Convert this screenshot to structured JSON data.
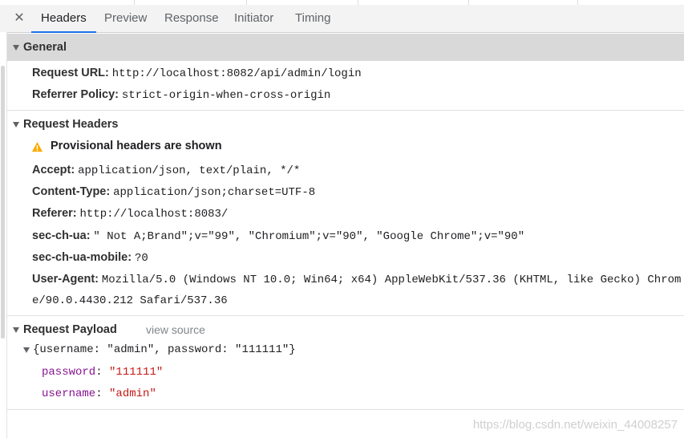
{
  "tabs": {
    "close": "✕",
    "items": [
      "Headers",
      "Preview",
      "Response",
      "Initiator",
      "Timing"
    ],
    "active": "Headers"
  },
  "general": {
    "title": "General",
    "request_url_label": "Request URL:",
    "request_url": "http://localhost:8082/api/admin/login",
    "referrer_policy_label": "Referrer Policy:",
    "referrer_policy": "strict-origin-when-cross-origin"
  },
  "request_headers": {
    "title": "Request Headers",
    "warning": "Provisional headers are shown",
    "items": [
      {
        "key": "Accept:",
        "value": "application/json, text/plain, */*"
      },
      {
        "key": "Content-Type:",
        "value": "application/json;charset=UTF-8"
      },
      {
        "key": "Referer:",
        "value": "http://localhost:8083/"
      },
      {
        "key": "sec-ch-ua:",
        "value": "\" Not A;Brand\";v=\"99\", \"Chromium\";v=\"90\", \"Google Chrome\";v=\"90\""
      },
      {
        "key": "sec-ch-ua-mobile:",
        "value": "?0"
      },
      {
        "key": "User-Agent:",
        "value": "Mozilla/5.0 (Windows NT 10.0; Win64; x64) AppleWebKit/537.36 (KHTML, like Gecko) Chrom"
      }
    ],
    "user_agent_cont": "e/90.0.4430.212 Safari/537.36"
  },
  "payload": {
    "title": "Request Payload",
    "view_source": "view source",
    "summary": "{username: \"admin\", password: \"111111\"}",
    "props": [
      {
        "key": "password",
        "value": "\"111111\""
      },
      {
        "key": "username",
        "value": "\"admin\""
      }
    ]
  },
  "watermark": "https://blog.csdn.net/weixin_44008257",
  "colors": {
    "accent": "#1a73e8",
    "warning": "#f9ab00",
    "prop_key": "#881391",
    "prop_value": "#c41a16"
  }
}
